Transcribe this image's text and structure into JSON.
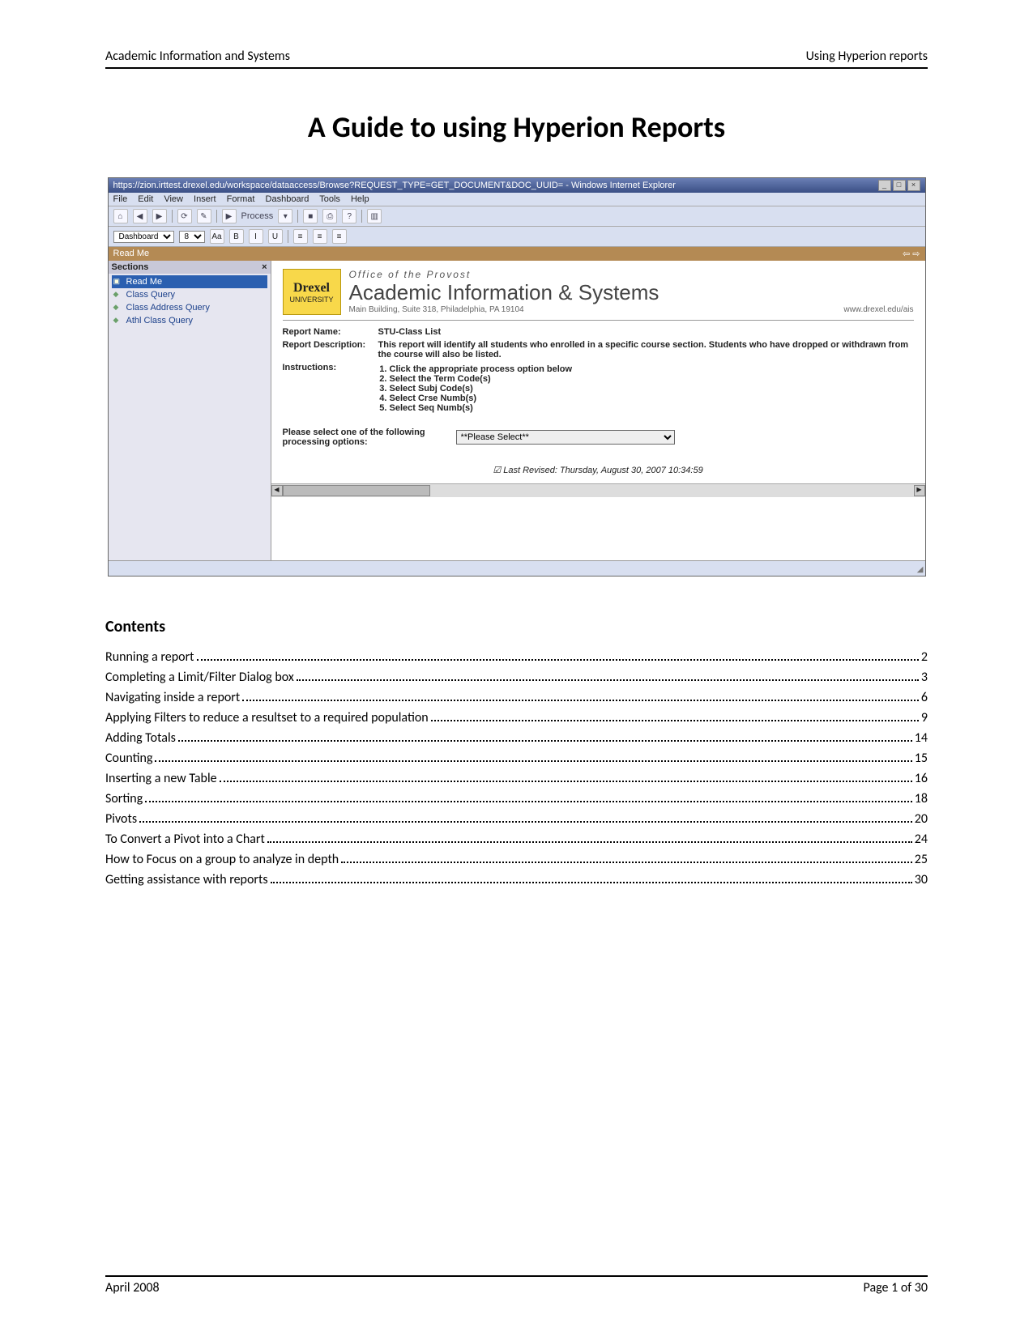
{
  "header": {
    "left": "Academic Information and Systems",
    "right": "Using Hyperion reports"
  },
  "title": "A Guide to using Hyperion Reports",
  "browser": {
    "url": "https://zion.irttest.drexel.edu/workspace/dataaccess/Browse?REQUEST_TYPE=GET_DOCUMENT&DOC_UUID= -  Windows Internet Explorer",
    "menu": [
      "File",
      "Edit",
      "View",
      "Insert",
      "Format",
      "Dashboard",
      "Tools",
      "Help"
    ],
    "process_label": "Process",
    "tab_label": "Read Me",
    "sidebar": {
      "header": "Sections",
      "items": [
        "Read Me",
        "Class Query",
        "Class Address Query",
        "Athl Class Query"
      ]
    },
    "pane": {
      "office": "Office of the Provost",
      "system": "Academic Information & Systems",
      "addr": "Main Building, Suite 318, Philadelphia, PA 19104",
      "url": "www.drexel.edu/ais",
      "logo_main": "Drexel",
      "logo_sub": "UNIVERSITY",
      "fields": {
        "name_label": "Report Name:",
        "name_value": "STU-Class List",
        "desc_label": "Report Description:",
        "desc_value": "This report will identify all students who enrolled in a specific course section. Students who have dropped or withdrawn from the course will also be listed.",
        "inst_label": "Instructions:",
        "inst_items": [
          "Click the appropriate process option below",
          "Select the Term Code(s)",
          "Select Subj Code(s)",
          "Select Crse Numb(s)",
          "Select Seq Numb(s)"
        ]
      },
      "process_prompt": "Please select one of the following processing options:",
      "process_select": "**Please Select**",
      "revised": "Last Revised: Thursday, August 30, 2007 10:34:59"
    }
  },
  "contents": {
    "heading": "Contents",
    "items": [
      {
        "label": "Running a report",
        "page": "2"
      },
      {
        "label": "Completing a Limit/Filter Dialog box",
        "page": "3"
      },
      {
        "label": "Navigating inside a report",
        "page": "6"
      },
      {
        "label": "Applying Filters to reduce a resultset to a required population",
        "page": "9"
      },
      {
        "label": "Adding Totals",
        "page": "14"
      },
      {
        "label": "Counting",
        "page": "15"
      },
      {
        "label": "Inserting a new Table",
        "page": "16"
      },
      {
        "label": "Sorting",
        "page": "18"
      },
      {
        "label": "Pivots",
        "page": "20"
      },
      {
        "label": "To Convert a Pivot into a Chart",
        "page": "24"
      },
      {
        "label": "How to Focus on a group to analyze in depth",
        "page": "25"
      },
      {
        "label": "Getting assistance with reports",
        "page": "30"
      }
    ]
  },
  "footer": {
    "left": "April 2008",
    "right": "Page 1 of 30"
  }
}
